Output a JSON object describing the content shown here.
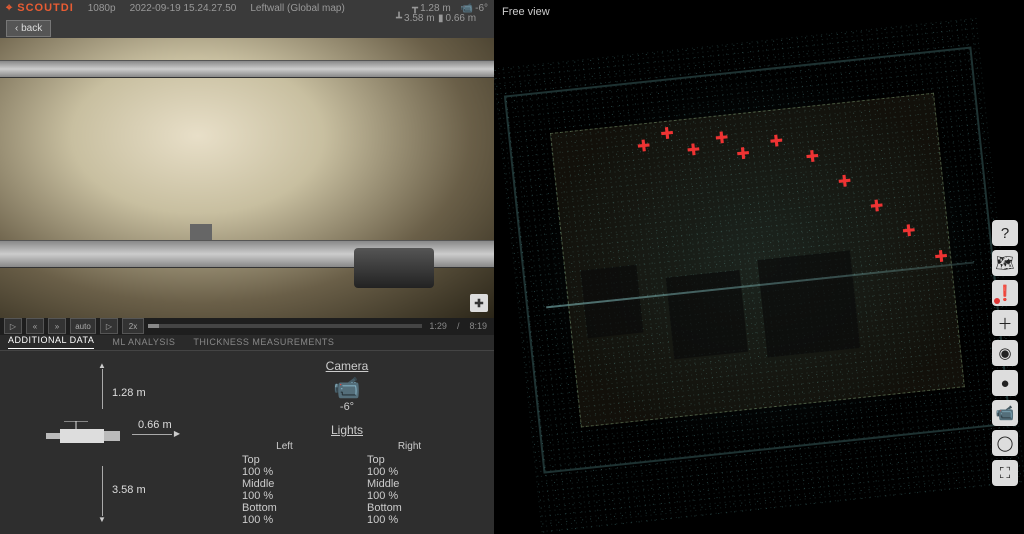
{
  "brand": "SCOUTDI",
  "header": {
    "resolution": "1080p",
    "timestamp": "2022-09-19 15.24.27.50",
    "location": "Leftwall (Global map)",
    "dist_up": "1.28 m",
    "cam": "-6°",
    "dist_down": "3.58 m",
    "dist_side": "0.66 m"
  },
  "nav": {
    "back": "‹ back"
  },
  "player": {
    "play": "▷",
    "rew": "«",
    "ff": "»",
    "auto": "auto",
    "rec": "▷",
    "speed": "2x",
    "current": "1:29",
    "total": "8:19"
  },
  "overlay": {
    "expand": "✚"
  },
  "tabs": {
    "t1": "ADDITIONAL DATA",
    "t2": "ML ANALYSIS",
    "t3": "THICKNESS MEASUREMENTS"
  },
  "dims": {
    "up": "1.28 m",
    "side": "0.66 m",
    "down": "3.58 m"
  },
  "camera": {
    "title": "Camera",
    "angle": "-6°",
    "icon": "📹"
  },
  "lights": {
    "title": "Lights",
    "left": "Left",
    "right": "Right",
    "rows": [
      {
        "lbl": "Top",
        "lv": "100 %",
        "rv": "100 %"
      },
      {
        "lbl": "Middle",
        "lv": "100 %",
        "rv": "100 %"
      },
      {
        "lbl": "Bottom",
        "lv": "100 %",
        "rv": "100 %"
      }
    ]
  },
  "right": {
    "mode": "Free view",
    "tools": {
      "help": "?",
      "map": "🗺",
      "alert": "❗",
      "add": "＋",
      "eye": "◉",
      "dot": "●",
      "cam": "📹",
      "circle": "◯",
      "full": "⛶"
    }
  }
}
